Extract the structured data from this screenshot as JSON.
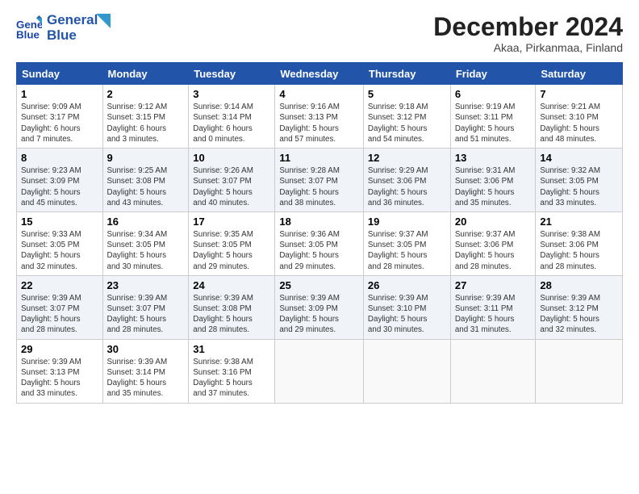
{
  "header": {
    "logo_line1": "General",
    "logo_line2": "Blue",
    "month_title": "December 2024",
    "location": "Akaa, Pirkanmaa, Finland"
  },
  "columns": [
    "Sunday",
    "Monday",
    "Tuesday",
    "Wednesday",
    "Thursday",
    "Friday",
    "Saturday"
  ],
  "weeks": [
    [
      {
        "day": "1",
        "info": "Sunrise: 9:09 AM\nSunset: 3:17 PM\nDaylight: 6 hours\nand 7 minutes."
      },
      {
        "day": "2",
        "info": "Sunrise: 9:12 AM\nSunset: 3:15 PM\nDaylight: 6 hours\nand 3 minutes."
      },
      {
        "day": "3",
        "info": "Sunrise: 9:14 AM\nSunset: 3:14 PM\nDaylight: 6 hours\nand 0 minutes."
      },
      {
        "day": "4",
        "info": "Sunrise: 9:16 AM\nSunset: 3:13 PM\nDaylight: 5 hours\nand 57 minutes."
      },
      {
        "day": "5",
        "info": "Sunrise: 9:18 AM\nSunset: 3:12 PM\nDaylight: 5 hours\nand 54 minutes."
      },
      {
        "day": "6",
        "info": "Sunrise: 9:19 AM\nSunset: 3:11 PM\nDaylight: 5 hours\nand 51 minutes."
      },
      {
        "day": "7",
        "info": "Sunrise: 9:21 AM\nSunset: 3:10 PM\nDaylight: 5 hours\nand 48 minutes."
      }
    ],
    [
      {
        "day": "8",
        "info": "Sunrise: 9:23 AM\nSunset: 3:09 PM\nDaylight: 5 hours\nand 45 minutes."
      },
      {
        "day": "9",
        "info": "Sunrise: 9:25 AM\nSunset: 3:08 PM\nDaylight: 5 hours\nand 43 minutes."
      },
      {
        "day": "10",
        "info": "Sunrise: 9:26 AM\nSunset: 3:07 PM\nDaylight: 5 hours\nand 40 minutes."
      },
      {
        "day": "11",
        "info": "Sunrise: 9:28 AM\nSunset: 3:07 PM\nDaylight: 5 hours\nand 38 minutes."
      },
      {
        "day": "12",
        "info": "Sunrise: 9:29 AM\nSunset: 3:06 PM\nDaylight: 5 hours\nand 36 minutes."
      },
      {
        "day": "13",
        "info": "Sunrise: 9:31 AM\nSunset: 3:06 PM\nDaylight: 5 hours\nand 35 minutes."
      },
      {
        "day": "14",
        "info": "Sunrise: 9:32 AM\nSunset: 3:05 PM\nDaylight: 5 hours\nand 33 minutes."
      }
    ],
    [
      {
        "day": "15",
        "info": "Sunrise: 9:33 AM\nSunset: 3:05 PM\nDaylight: 5 hours\nand 32 minutes."
      },
      {
        "day": "16",
        "info": "Sunrise: 9:34 AM\nSunset: 3:05 PM\nDaylight: 5 hours\nand 30 minutes."
      },
      {
        "day": "17",
        "info": "Sunrise: 9:35 AM\nSunset: 3:05 PM\nDaylight: 5 hours\nand 29 minutes."
      },
      {
        "day": "18",
        "info": "Sunrise: 9:36 AM\nSunset: 3:05 PM\nDaylight: 5 hours\nand 29 minutes."
      },
      {
        "day": "19",
        "info": "Sunrise: 9:37 AM\nSunset: 3:05 PM\nDaylight: 5 hours\nand 28 minutes."
      },
      {
        "day": "20",
        "info": "Sunrise: 9:37 AM\nSunset: 3:06 PM\nDaylight: 5 hours\nand 28 minutes."
      },
      {
        "day": "21",
        "info": "Sunrise: 9:38 AM\nSunset: 3:06 PM\nDaylight: 5 hours\nand 28 minutes."
      }
    ],
    [
      {
        "day": "22",
        "info": "Sunrise: 9:39 AM\nSunset: 3:07 PM\nDaylight: 5 hours\nand 28 minutes."
      },
      {
        "day": "23",
        "info": "Sunrise: 9:39 AM\nSunset: 3:07 PM\nDaylight: 5 hours\nand 28 minutes."
      },
      {
        "day": "24",
        "info": "Sunrise: 9:39 AM\nSunset: 3:08 PM\nDaylight: 5 hours\nand 28 minutes."
      },
      {
        "day": "25",
        "info": "Sunrise: 9:39 AM\nSunset: 3:09 PM\nDaylight: 5 hours\nand 29 minutes."
      },
      {
        "day": "26",
        "info": "Sunrise: 9:39 AM\nSunset: 3:10 PM\nDaylight: 5 hours\nand 30 minutes."
      },
      {
        "day": "27",
        "info": "Sunrise: 9:39 AM\nSunset: 3:11 PM\nDaylight: 5 hours\nand 31 minutes."
      },
      {
        "day": "28",
        "info": "Sunrise: 9:39 AM\nSunset: 3:12 PM\nDaylight: 5 hours\nand 32 minutes."
      }
    ],
    [
      {
        "day": "29",
        "info": "Sunrise: 9:39 AM\nSunset: 3:13 PM\nDaylight: 5 hours\nand 33 minutes."
      },
      {
        "day": "30",
        "info": "Sunrise: 9:39 AM\nSunset: 3:14 PM\nDaylight: 5 hours\nand 35 minutes."
      },
      {
        "day": "31",
        "info": "Sunrise: 9:38 AM\nSunset: 3:16 PM\nDaylight: 5 hours\nand 37 minutes."
      },
      {
        "day": "",
        "info": ""
      },
      {
        "day": "",
        "info": ""
      },
      {
        "day": "",
        "info": ""
      },
      {
        "day": "",
        "info": ""
      }
    ]
  ]
}
